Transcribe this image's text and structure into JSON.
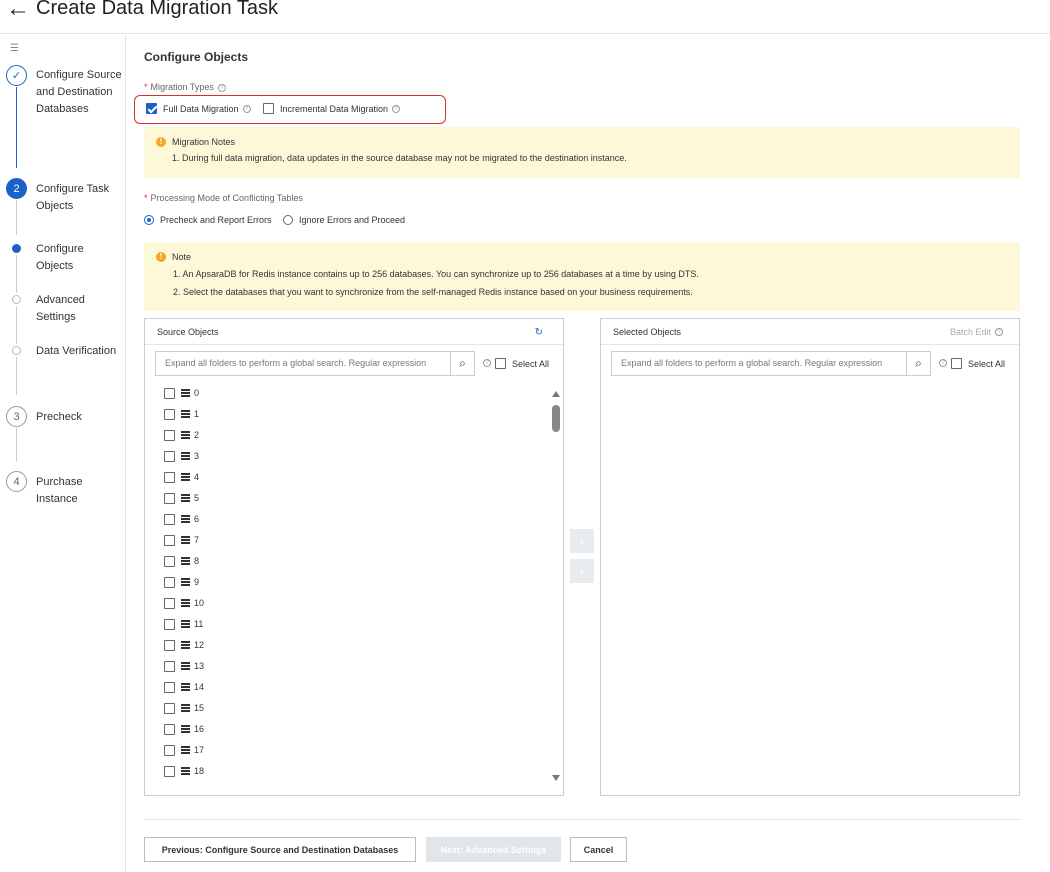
{
  "header": {
    "back_icon": "arrow-left-icon",
    "title": "Create Data Migration Task"
  },
  "steps": {
    "s1": {
      "node": "✓",
      "label": "Configure Source and Destination Databases"
    },
    "s2": {
      "node": "2",
      "label": "Configure Task Objects"
    },
    "s2a": {
      "label": "Configure Objects"
    },
    "s2b": {
      "label": "Advanced Settings"
    },
    "s2c": {
      "label": "Data Verification"
    },
    "s3": {
      "node": "3",
      "label": "Precheck"
    },
    "s4": {
      "node": "4",
      "label": "Purchase Instance"
    }
  },
  "form": {
    "section_title": "Configure Objects",
    "migration_types_label": "Migration Types",
    "full_data_migration": "Full Data Migration",
    "incremental_data_migration": "Incremental Data Migration",
    "full_checked": true,
    "incremental_checked": false,
    "processing_mode_label": "Processing Mode of Conflicting Tables",
    "precheck_option": "Precheck and Report Errors",
    "ignore_option": "Ignore Errors and Proceed",
    "selected_mode": "Precheck and Report Errors"
  },
  "migration_notes": {
    "title": "Migration Notes",
    "line1": "1. During full data migration, data updates in the source database may not be migrated to the destination instance."
  },
  "note": {
    "title": "Note",
    "line1": "1. An ApsaraDB for Redis instance contains up to 256 databases. You can synchronize up to 256 databases at a time by using DTS.",
    "line2": "2. Select the databases that you want to synchronize from the self-managed Redis instance based on your business requirements."
  },
  "source_panel": {
    "title": "Source Objects",
    "search_placeholder": "Expand all folders to perform a global search. Regular expression",
    "select_all": "Select All",
    "items": [
      "0",
      "1",
      "2",
      "3",
      "4",
      "5",
      "6",
      "7",
      "8",
      "9",
      "10",
      "11",
      "12",
      "13",
      "14",
      "15",
      "16",
      "17",
      "18"
    ]
  },
  "selected_panel": {
    "title": "Selected Objects",
    "batch_edit": "Batch Edit",
    "search_placeholder": "Expand all folders to perform a global search. Regular expression",
    "select_all": "Select All"
  },
  "transfer": {
    "add": "›",
    "remove": "‹"
  },
  "footer": {
    "previous": "Previous: Configure Source and Destination Databases",
    "next": "Next: Advanced Settings",
    "cancel": "Cancel"
  },
  "colors": {
    "accent": "#1a62c6",
    "highlight_border": "#d93026",
    "notice_bg": "#fdf8d8"
  }
}
